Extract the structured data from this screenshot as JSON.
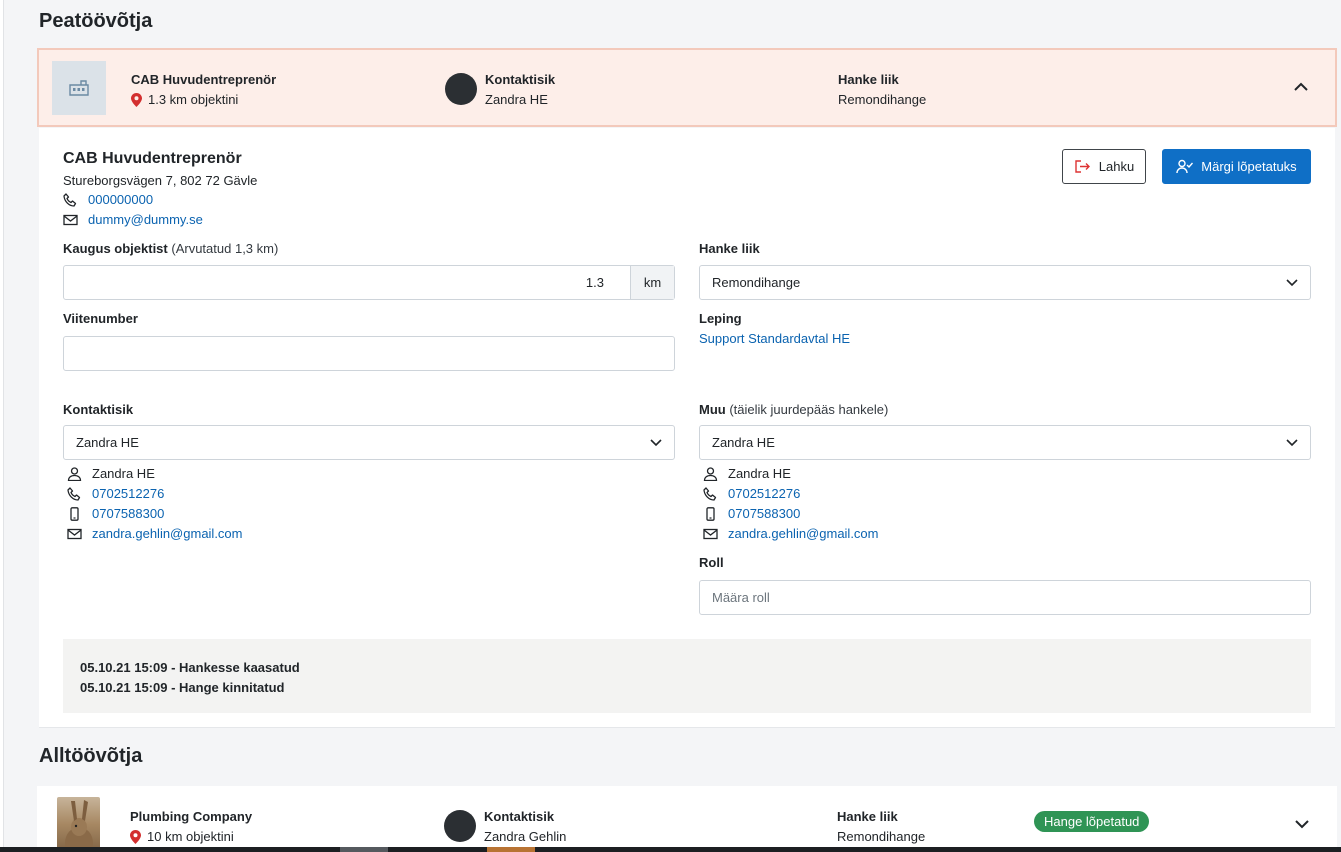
{
  "main_contractor": {
    "section_title": "Peatöövõtja",
    "company": "CAB Huvudentreprenör",
    "distance": "1.3 km objektini",
    "contact_label": "Kontaktisik",
    "contact_value": "Zandra HE",
    "type_label": "Hanke liik",
    "type_value": "Remondihange",
    "details": {
      "name": "CAB Huvudentreprenör",
      "address": "Stureborgsvägen 7, 802 72 Gävle",
      "phone": "000000000",
      "email": "dummy@dummy.se",
      "leave_button": "Lahku",
      "finish_button": "Märgi lõpetatuks",
      "distance_label": "Kaugus objektist",
      "distance_hint": "(Arvutatud 1,3 km)",
      "distance_value": "1.3",
      "distance_unit": "km",
      "type_label": "Hanke liik",
      "type_value": "Remondihange",
      "reference_label": "Viitenumber",
      "reference_value": "",
      "contract_label": "Leping",
      "contract_value": "Support Standardavtal HE",
      "contact_label": "Kontaktisik",
      "contact_select": "Zandra HE",
      "contact": {
        "name": "Zandra HE",
        "phone": "0702512276",
        "mobile": "0707588300",
        "email": "zandra.gehlin@gmail.com"
      },
      "other_label": "Muu",
      "other_hint": "(täielik juurdepääs hankele)",
      "other_select": "Zandra HE",
      "other": {
        "name": "Zandra HE",
        "phone": "0702512276",
        "mobile": "0707588300",
        "email": "zandra.gehlin@gmail.com"
      },
      "role_label": "Roll",
      "role_placeholder": "Määra roll",
      "history": [
        "05.10.21 15:09 - Hankesse kaasatud",
        "05.10.21 15:09 - Hange kinnitatud"
      ]
    }
  },
  "subcontractor": {
    "section_title": "Alltöövõtja",
    "company": "Plumbing Company",
    "distance": "10 km objektini",
    "contact_label": "Kontaktisik",
    "contact_value": "Zandra Gehlin",
    "type_label": "Hanke liik",
    "type_value": "Remondihange",
    "status_badge": "Hange lõpetatud"
  },
  "colors": {
    "primary": "#0f6fc6",
    "link": "#0b63b0",
    "header_bg": "#fdeee9",
    "header_border": "#f3c9bb",
    "badge_green": "#2f9455",
    "pin_red": "#d32f2f"
  }
}
